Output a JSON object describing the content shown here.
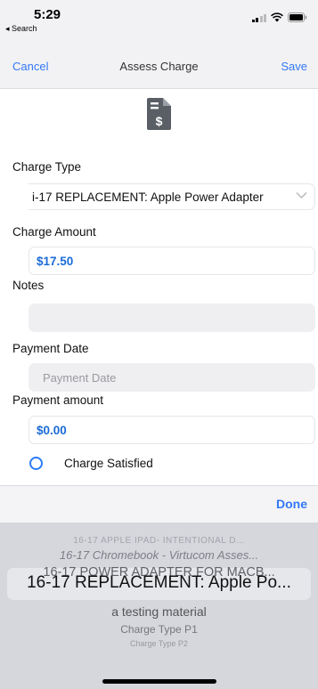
{
  "status_bar": {
    "time": "5:29",
    "back_app": "◂ Search"
  },
  "nav": {
    "cancel": "Cancel",
    "title": "Assess Charge",
    "save": "Save"
  },
  "form": {
    "charge_type_label": "Charge Type",
    "charge_type_value": "i-17 REPLACEMENT: Apple Power Adapter",
    "charge_amount_label": "Charge Amount",
    "charge_amount_value": "$17.50",
    "notes_label": "Notes",
    "notes_value": "",
    "payment_date_label": "Payment Date",
    "payment_date_placeholder": "Payment Date",
    "payment_amount_label": "Payment amount",
    "payment_amount_value": "$0.00",
    "charge_satisfied_label": "Charge Satisfied"
  },
  "toolbar": {
    "done": "Done"
  },
  "picker": {
    "options": [
      "16-17 APPLE IPAD- INTENTIONAL D...",
      "16-17 Chromebook - Virtucom Asses...",
      "16-17 POWER ADAPTER FOR MACB...",
      "16-17 REPLACEMENT: Apple Po...",
      "a testing material",
      "Charge Type P1",
      "Charge Type P2"
    ],
    "selected_index": 3
  },
  "colors": {
    "accent": "#3478f6",
    "value_blue": "#1a6bd6"
  },
  "icons": [
    "back-arrow-icon",
    "signal-icon",
    "wifi-icon",
    "battery-icon",
    "invoice-dollar-icon",
    "chevron-down-icon"
  ]
}
